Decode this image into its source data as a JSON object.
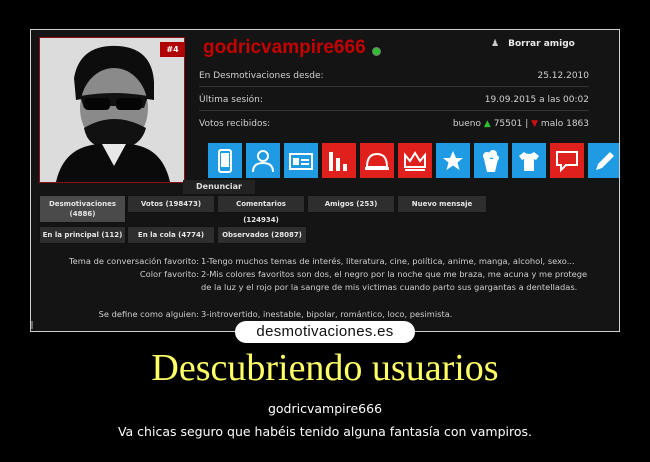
{
  "profile": {
    "rank": "#4",
    "username": "godricvampire666",
    "action_remove": "Borrar amigo",
    "rows": [
      {
        "label": "En Desmotivaciones desde:",
        "value": "25.12.2010"
      },
      {
        "label": "Última sesión:",
        "value": "19.09.2015 a las 00:02"
      }
    ],
    "votes": {
      "label": "Votos recibidos:",
      "up_label": "bueno",
      "up_value": "75501",
      "sep": "|",
      "down_label": "malo",
      "down_value": "1863"
    },
    "icons": [
      {
        "name": "phone-icon",
        "color": "#1e9be3"
      },
      {
        "name": "user-icon",
        "color": "#1e9be3"
      },
      {
        "name": "id-card-icon",
        "color": "#1e9be3"
      },
      {
        "name": "bar-chart-icon",
        "color": "#e0201c"
      },
      {
        "name": "helmet-icon",
        "color": "#e0201c"
      },
      {
        "name": "crown-icon",
        "color": "#e0201c"
      },
      {
        "name": "star-badge-icon",
        "color": "#1e9be3"
      },
      {
        "name": "popcorn-icon",
        "color": "#1e9be3"
      },
      {
        "name": "shirt-icon",
        "color": "#1e9be3"
      },
      {
        "name": "speech-bubble-icon",
        "color": "#e0201c"
      },
      {
        "name": "pen-icon",
        "color": "#1e9be3"
      }
    ],
    "report": "Denunciar"
  },
  "tabs_row1": [
    "Desmotivaciones\n(4886)",
    "Votos (198473)",
    "Comentarios (124934)",
    "Amigos (253)",
    "Nuevo mensaje"
  ],
  "tabs_row2": [
    "En la principal (112)",
    "En la cola (4774)",
    "Observados (28087)"
  ],
  "info": {
    "topic_label": "Tema de conversación favorito:",
    "topic_value": "1-Tengo muchos temas de interés, literatura, cine, política, anime, manga, alcohol, sexo...",
    "color_label": "Color favorito:",
    "color_value": "2-Mis colores favoritos son dos, el negro por la noche que me braza, me acuna y me protege de la luz y el rojo por la sangre de mis victimas cuando parto sus gargantas a dentelladas.",
    "self_label": "Se define como alguien:",
    "self_value": "3-introvertido, inestable, bipolar, romántico, loco, pesimista."
  },
  "site_logo": "desmotivaciones.es",
  "poster": {
    "title": "Descubriendo usuarios",
    "line1": "godricvampire666",
    "line2": "Va chicas seguro que habéis tenido alguna fantasía con vampiros."
  }
}
